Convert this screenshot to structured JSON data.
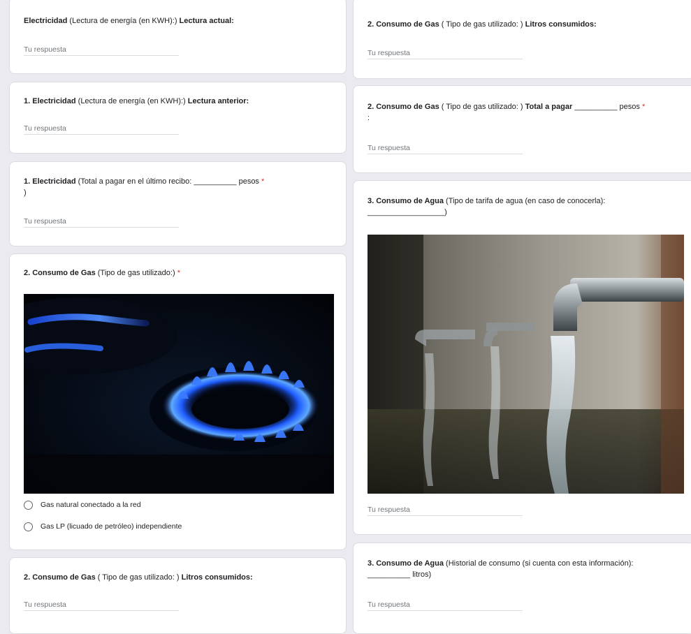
{
  "answer_placeholder": "Tu respuesta",
  "q_elec_actual": {
    "b1": "Electricidad",
    "t1": " (Lectura de energía (en KWH):) ",
    "b2": "Lectura actual:"
  },
  "q_elec_anterior": {
    "b1": "1. Electricidad",
    "t1": " (Lectura de energía (en KWH):) ",
    "b2": "Lectura anterior:"
  },
  "q_elec_total": {
    "b1": "1. Electricidad",
    "t1": " (Total a pagar en el último recibo: __________ pesos ",
    "req": "*",
    "t2": ")"
  },
  "q_gas_tipo": {
    "b1": "2. Consumo de Gas",
    "t1": " (Tipo de gas utilizado:) ",
    "req": "*",
    "options": [
      "Gas natural conectado a la red",
      "Gas LP (licuado de petróleo) independiente"
    ]
  },
  "q_gas_litros": {
    "b1": "2. Consumo de Gas",
    "t1": " ( Tipo de gas utilizado:  ) ",
    "b2": "Litros consumidos:"
  },
  "q_gas_total": {
    "b1": "2. Consumo de Gas",
    "t1": " ( Tipo de gas utilizado:  ) ",
    "b2": "Total a pagar",
    "t2": " __________ pesos ",
    "req": "*",
    "t3": ":"
  },
  "q_agua_tarifa": {
    "b1": "3. Consumo de Agua",
    "t1": " (Tipo de tarifa de agua (en caso de conocerla):",
    "t2": "__________________)"
  },
  "q_agua_historial": {
    "b1": "3. Consumo de Agua",
    "t1": " (Historial de consumo (si cuenta con esta información):",
    "t2": "__________ litros)"
  },
  "colors": {
    "required": "#d93025",
    "background": "#eceaf1",
    "card": "#ffffff"
  }
}
